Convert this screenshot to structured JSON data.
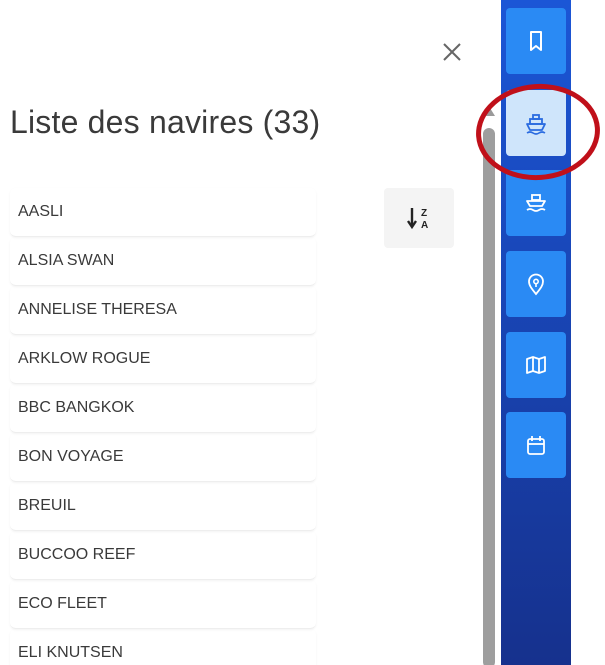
{
  "panel": {
    "title": "Liste des navires (33)",
    "vessels": [
      "AASLI",
      "ALSIA SWAN",
      "ANNELISE THERESA",
      "ARKLOW ROGUE",
      "BBC BANGKOK",
      "BON VOYAGE",
      "BREUIL",
      "BUCCOO REEF",
      "ECO FLEET",
      "ELI KNUTSEN"
    ]
  },
  "sort": {
    "icon": "sort-z-a-icon"
  },
  "sidebar": {
    "items": [
      {
        "icon": "bookmark-icon",
        "active": false
      },
      {
        "icon": "ship-icon",
        "active": true
      },
      {
        "icon": "ship-waves-icon",
        "active": false
      },
      {
        "icon": "location-pin-icon",
        "active": false
      },
      {
        "icon": "map-icon",
        "active": false
      },
      {
        "icon": "calendar-icon",
        "active": false
      }
    ]
  },
  "colors": {
    "sidebar_bg_top": "#1b56d6",
    "sidebar_bg_bottom": "#16318d",
    "sidebar_button": "#2a8af4",
    "sidebar_button_active": "#cfe5fb",
    "annotation": "#c0101a",
    "text": "#3a3a3a"
  }
}
